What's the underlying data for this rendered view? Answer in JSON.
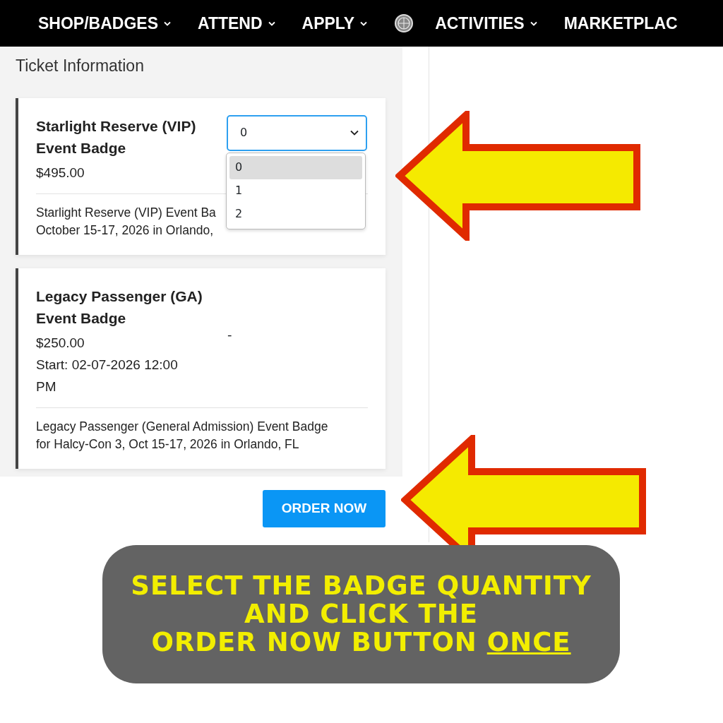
{
  "nav": {
    "items": [
      {
        "kind": "link",
        "label": "SHOP/BADGES",
        "caret": true
      },
      {
        "kind": "link",
        "label": "ATTEND",
        "caret": true
      },
      {
        "kind": "link",
        "label": "APPLY",
        "caret": true
      },
      {
        "kind": "logo"
      },
      {
        "kind": "link",
        "label": "ACTIVITIES",
        "caret": true
      },
      {
        "kind": "link",
        "label": "MARKETPLAC",
        "caret": false
      }
    ]
  },
  "section_title": "Ticket Information",
  "tickets": [
    {
      "name": "Starlight Reserve (VIP) Event Badge",
      "price": "$495.00",
      "description": [
        "Starlight Reserve (VIP) Event Ba",
        "October 15-17, 2026 in Orlando,"
      ],
      "quantity": {
        "kind": "select",
        "value": "0",
        "open": true,
        "options": [
          {
            "label": "0",
            "selected": true
          },
          {
            "label": "1",
            "selected": false
          },
          {
            "label": "2",
            "selected": false
          }
        ]
      }
    },
    {
      "name": "Legacy Passenger (GA) Event Badge",
      "price": "$250.00",
      "start": "Start: 02-07-2026 12:00 PM",
      "description": [
        "Legacy Passenger (General Admission) Event Badge",
        "for Halcy-Con 3, Oct 15-17, 2026 in Orlando, FL"
      ],
      "quantity": {
        "kind": "text",
        "value": "-"
      }
    }
  ],
  "order_button": "ORDER NOW",
  "annotation": {
    "callout": [
      [
        {
          "text": "SELECT THE BADGE QUANTITY",
          "underlined": false
        }
      ],
      [
        {
          "text": "AND CLICK THE",
          "underlined": false
        }
      ],
      [
        {
          "text": "ORDER NOW BUTTON ",
          "underlined": false
        },
        {
          "text": "ONCE",
          "underlined": true
        }
      ]
    ]
  }
}
